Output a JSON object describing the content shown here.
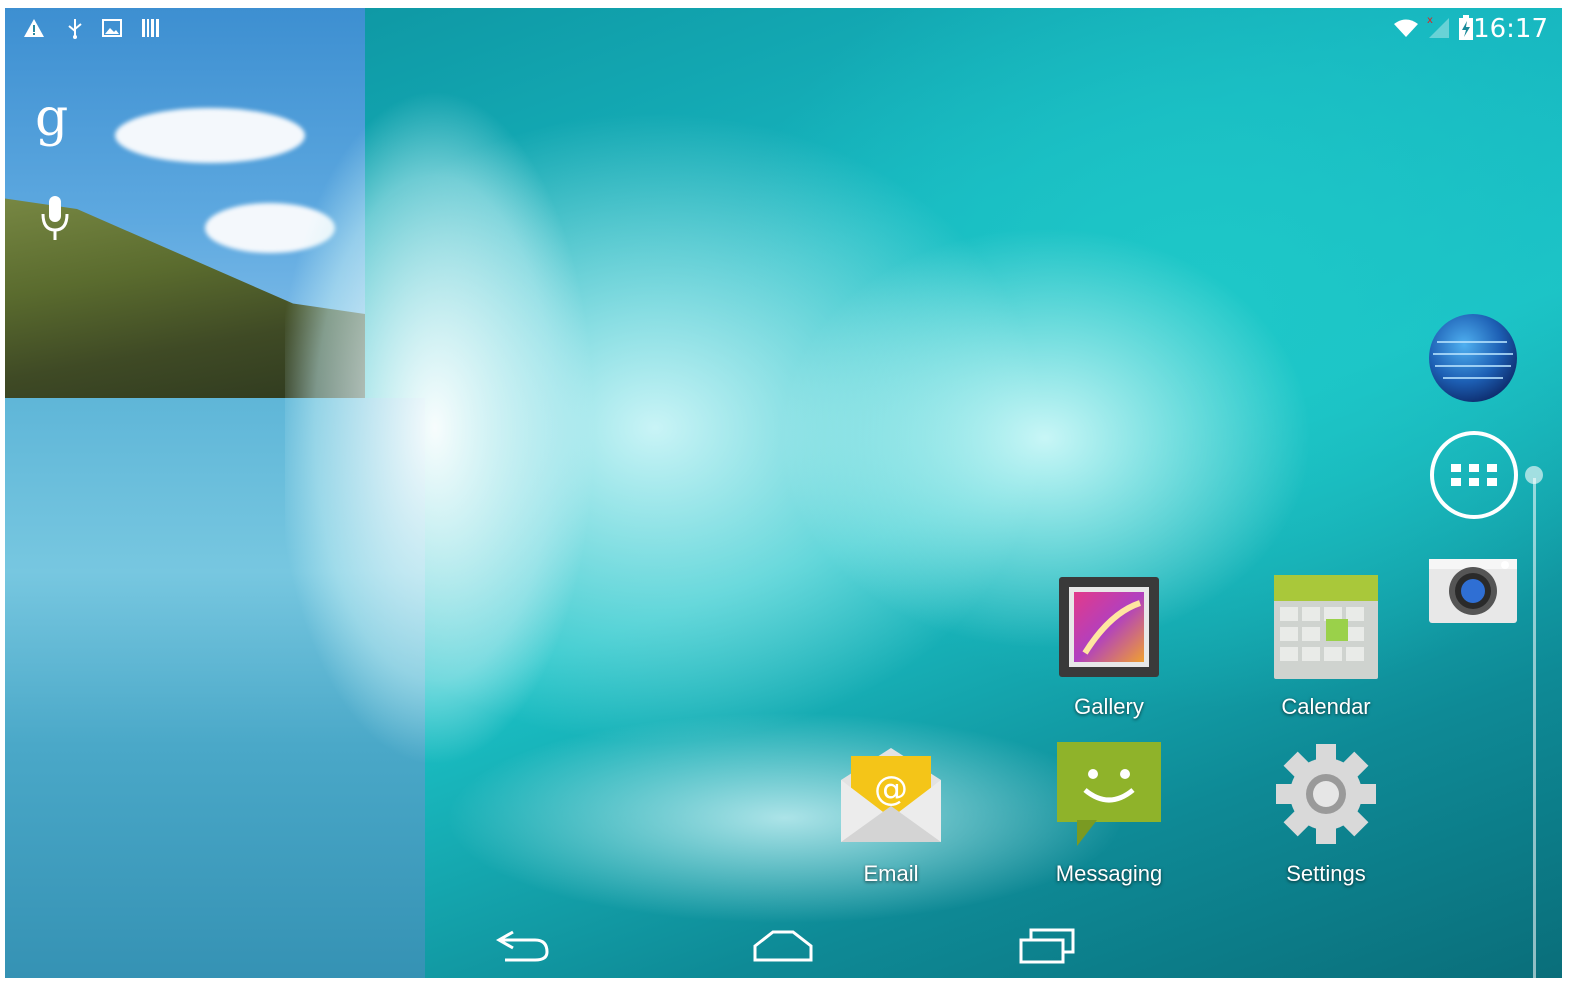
{
  "status_bar": {
    "time": "16:17",
    "left_icons": [
      "warning-icon",
      "usb-icon",
      "image-notification-icon",
      "barcode-icon"
    ],
    "right_icons": [
      "wifi-icon",
      "no-signal-icon",
      "battery-charging-icon"
    ]
  },
  "search_widget": {
    "google_letter": "g",
    "voice_icon": "mic-icon"
  },
  "apps": [
    {
      "name": "Gallery",
      "icon": "gallery-icon"
    },
    {
      "name": "Calendar",
      "icon": "calendar-icon"
    },
    {
      "name": "Email",
      "icon": "email-icon"
    },
    {
      "name": "Messaging",
      "icon": "messaging-icon"
    },
    {
      "name": "Settings",
      "icon": "settings-icon"
    }
  ],
  "dock": {
    "items": [
      "browser-globe-icon",
      "all-apps-icon",
      "camera-icon"
    ]
  },
  "nav_bar": {
    "buttons": [
      "back-icon",
      "home-icon",
      "recents-icon"
    ]
  },
  "colors": {
    "accent_wave": "#1bc2c6",
    "text": "#ffffff"
  }
}
